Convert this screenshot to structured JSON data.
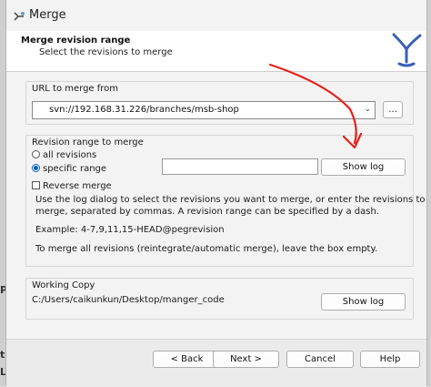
{
  "window": {
    "title": "Merge"
  },
  "header": {
    "title": "Merge revision range",
    "subtitle": "Select the revisions to merge"
  },
  "url_group": {
    "label": "URL to merge from",
    "url_value": "svn://192.168.31.226/branches/msb-shop",
    "browse_label": "..."
  },
  "revision_group": {
    "label": "Revision range to merge",
    "all_revisions_label": "all revisions",
    "specific_range_label": "specific range",
    "range_value": "",
    "show_log_label": "Show log",
    "reverse_merge_label": "Reverse merge",
    "help_line1": "Use the log dialog to select the revisions you want to merge, or enter the revisions to",
    "help_line2": "merge, separated by commas. A revision range can be specified by a dash.",
    "example": "Example: 4-7,9,11,15-HEAD@pegrevision",
    "note": "To merge all revisions (reintegrate/automatic merge), leave the box empty."
  },
  "working_copy": {
    "label": "Working Copy",
    "path": "C:/Users/caikunkun/Desktop/manger_code",
    "show_log_label": "Show log"
  },
  "footer": {
    "back_label": "< Back",
    "next_label": "Next >",
    "cancel_label": "Cancel",
    "help_label": "Help"
  },
  "background_fragments": [
    "P",
    "t",
    "L"
  ],
  "colors": {
    "accent": "#005fb8",
    "annotation_arrow": "#e8201a"
  }
}
